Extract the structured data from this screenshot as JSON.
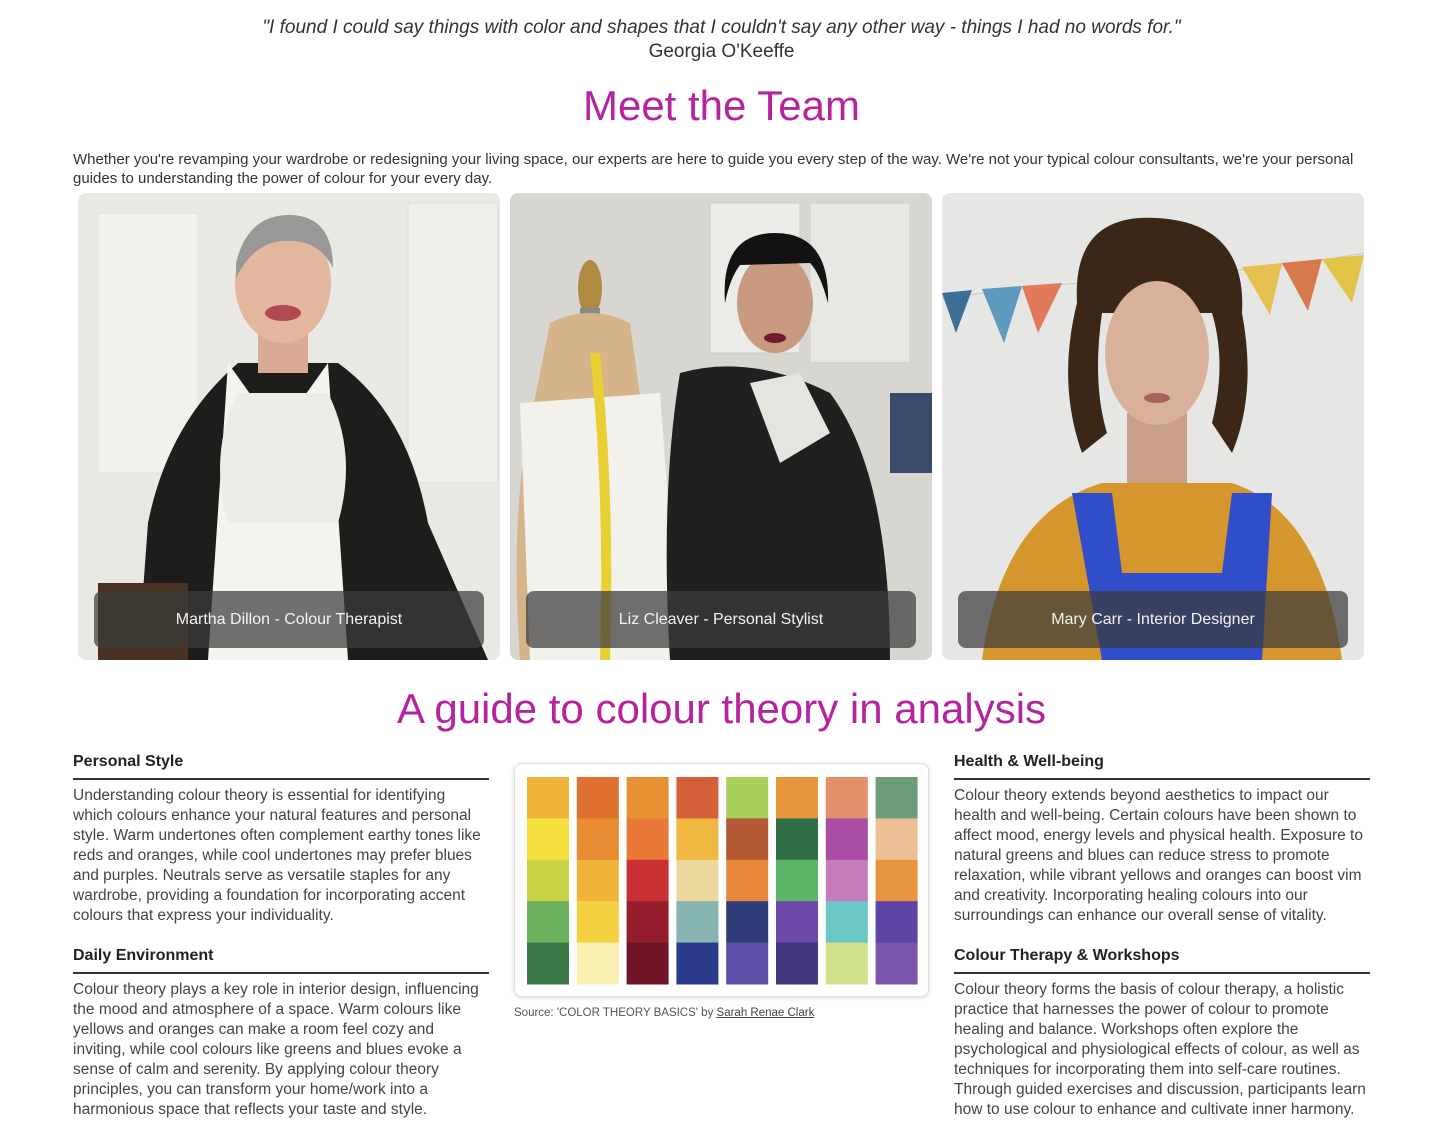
{
  "quote": {
    "text": "\"I found I could say things with color and shapes that I couldn't say any other way - things I had no words for.\"",
    "author": "Georgia O'Keeffe"
  },
  "team": {
    "title": "Meet the Team",
    "intro": "Whether you're revamping your wardrobe or redesigning your living space, our experts are here to guide you every step of the way. We're not your typical colour consultants, we're your personal guides to understanding the power of colour for your every day.",
    "members": [
      {
        "caption": "Martha Dillon - Colour Therapist"
      },
      {
        "caption": "Liz Cleaver - Personal Stylist"
      },
      {
        "caption": "Mary Carr - Interior Designer"
      }
    ]
  },
  "guide": {
    "title": "A guide to colour theory in analysis",
    "sections": {
      "personal_style": {
        "heading": "Personal Style",
        "body": "Understanding colour theory is essential for identifying which colours enhance your natural features and personal style. Warm undertones often complement earthy tones like reds and oranges, while cool undertones may prefer blues and purples. Neutrals serve as versatile staples for any wardrobe, providing a foundation for incorporating accent colours that express your individuality."
      },
      "daily_environment": {
        "heading": "Daily Environment",
        "body": "Colour theory plays a key role in interior design, influencing the mood and atmosphere of a space. Warm colours like yellows and oranges can make a room feel cozy and inviting, while cool colours like greens and blues evoke a sense of calm and serenity. By applying colour theory principles, you can transform your home/work into a harmonious space that reflects your taste and style."
      },
      "health": {
        "heading": "Health & Well-being",
        "body": "Colour theory extends beyond aesthetics to impact our health and well-being. Certain colours have been shown to affect mood, energy levels and physical health. Exposure to natural greens and blues can reduce stress to promote relaxation, while vibrant yellows and oranges can boost vim and creativity. Incorporating healing colours into our surroundings can enhance our overall sense of vitality."
      },
      "therapy": {
        "heading": "Colour Therapy & Workshops",
        "body": "Colour theory forms the basis of colour therapy, a holistic practice that harnesses the power of colour to promote healing and balance. Workshops often explore the psychological and physiological effects of colour, as well as techniques for incorporating them into self-care routines. Through guided exercises and discussion, participants learn how to use colour to enhance and cultivate inner harmony."
      }
    },
    "palette": {
      "columns": [
        [
          "#f0b43c",
          "#f5e040",
          "#c8d246",
          "#6cb460",
          "#3c7846"
        ],
        [
          "#e07030",
          "#e88c34",
          "#f0b43c",
          "#f2d040",
          "#f8f0b0"
        ],
        [
          "#e89034",
          "#e87838",
          "#c83034",
          "#961e2c",
          "#6e1424"
        ],
        [
          "#d4603a",
          "#f0b840",
          "#ecd89c",
          "#86b4b0",
          "#2c3c8c"
        ],
        [
          "#a8d05a",
          "#b45a34",
          "#e8883a",
          "#303c78",
          "#5c50a8"
        ],
        [
          "#e8983a",
          "#2e6e44",
          "#5cb468",
          "#6e48a8",
          "#44387c"
        ],
        [
          "#e4906c",
          "#a84ca4",
          "#c47cbc",
          "#6cc8c4",
          "#d0e28c"
        ],
        [
          "#6c9e7c",
          "#ecc094",
          "#e8963e",
          "#5c44a4",
          "#7c54ac"
        ]
      ],
      "source_prefix": "Source: 'COLOR THEORY BASICS' by ",
      "source_link": "Sarah Renae Clark"
    }
  }
}
